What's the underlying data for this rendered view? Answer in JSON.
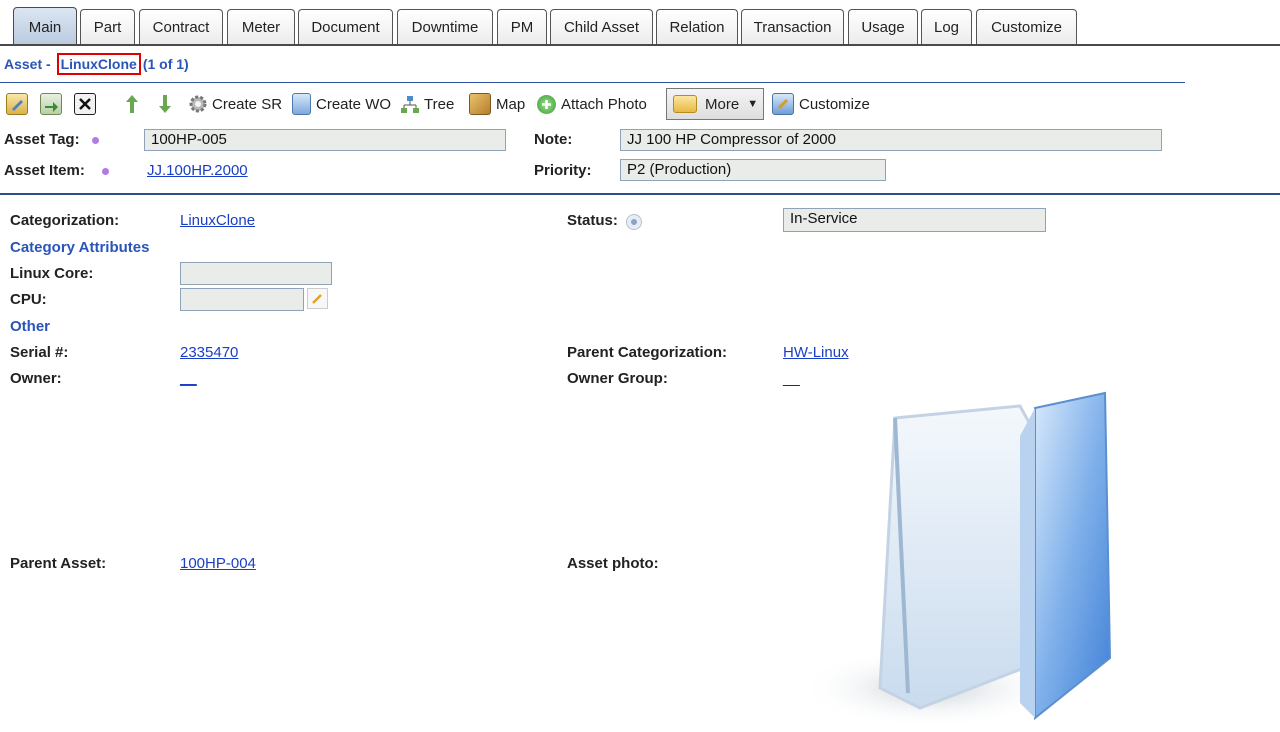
{
  "tabs": [
    {
      "label": "Main"
    },
    {
      "label": "Part"
    },
    {
      "label": "Contract"
    },
    {
      "label": "Meter"
    },
    {
      "label": "Document"
    },
    {
      "label": "Downtime"
    },
    {
      "label": "PM"
    },
    {
      "label": "Child Asset"
    },
    {
      "label": "Relation"
    },
    {
      "label": "Transaction"
    },
    {
      "label": "Usage"
    },
    {
      "label": "Log"
    },
    {
      "label": "Customize"
    }
  ],
  "header": {
    "prefix": "Asset - ",
    "name": "LinuxClone",
    "count": "(1 of 1)"
  },
  "toolbar": {
    "create_sr": "Create SR",
    "create_wo": "Create WO",
    "tree": "Tree",
    "map": "Map",
    "attach_photo": "Attach Photo",
    "more": "More",
    "customize": "Customize"
  },
  "top_form": {
    "asset_tag_label": "Asset Tag:",
    "asset_tag_value": "100HP-005",
    "asset_item_label": "Asset Item:",
    "asset_item_value": "JJ.100HP.2000",
    "note_label": "Note:",
    "note_value": "JJ 100 HP Compressor of 2000",
    "priority_label": "Priority:",
    "priority_value": "P2 (Production)"
  },
  "details": {
    "categorization_label": "Categorization:",
    "categorization_value": "LinuxClone",
    "status_label": "Status:",
    "status_value": "In-Service",
    "category_attributes": "Category Attributes",
    "linux_core_label": "Linux Core:",
    "linux_core_value": "",
    "cpu_label": "CPU:",
    "cpu_value": "",
    "other": "Other",
    "serial_label": "Serial #:",
    "serial_value": "2335470",
    "parent_cat_label": "Parent Categorization:",
    "parent_cat_value": "HW-Linux",
    "owner_label": "Owner:",
    "owner_value": "__",
    "owner_group_label": "Owner Group:",
    "owner_group_value": "__",
    "parent_asset_label": "Parent Asset:",
    "parent_asset_value": "100HP-004",
    "asset_photo_label": "Asset photo:"
  },
  "colors": {
    "accent": "#2a55b8",
    "link": "#1a3fc4",
    "highlight": "#e00000"
  }
}
